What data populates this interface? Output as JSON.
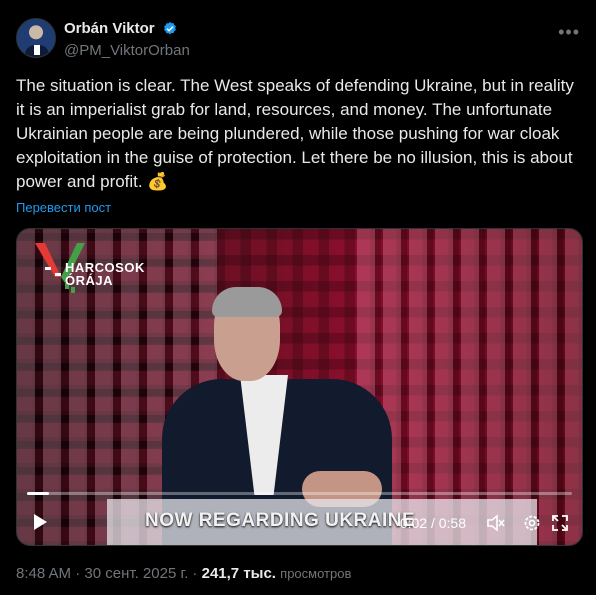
{
  "author": {
    "display_name": "Orbán Viktor",
    "handle": "@PM_ViktorOrban"
  },
  "tweet": {
    "text": "The situation is clear. The West speaks of defending Ukraine, but in reality it is an imperialist grab for land, resources, and money. The unfortunate Ukrainian people are being plundered, while those pushing for war cloak exploitation in the guise of protection. Let there be no illusion, this is about power and profit. 💰",
    "translate_label": "Перевести пост"
  },
  "video": {
    "logo_line1": "HARCOSOK",
    "logo_line2": "ÓRÁJA",
    "caption": "NOW REGARDING UKRAINE",
    "time_display": "0:02 / 0:58",
    "progress_fraction": 0.04
  },
  "meta": {
    "time": "8:48 AM",
    "separator": " · ",
    "date": "30 сент. 2025 г.",
    "views_count": "241,7 тыс.",
    "views_label": "просмотров"
  },
  "icons": {
    "verified": "verified-badge-icon",
    "more": "more-options-icon",
    "play": "play-icon",
    "mute": "volume-muted-icon",
    "settings": "settings-gear-icon",
    "fullscreen": "fullscreen-icon"
  },
  "colors": {
    "background": "#000000",
    "text_primary": "#e7e9ea",
    "text_secondary": "#71767b",
    "link": "#1d9bf0",
    "verified": "#1d9bf0"
  }
}
